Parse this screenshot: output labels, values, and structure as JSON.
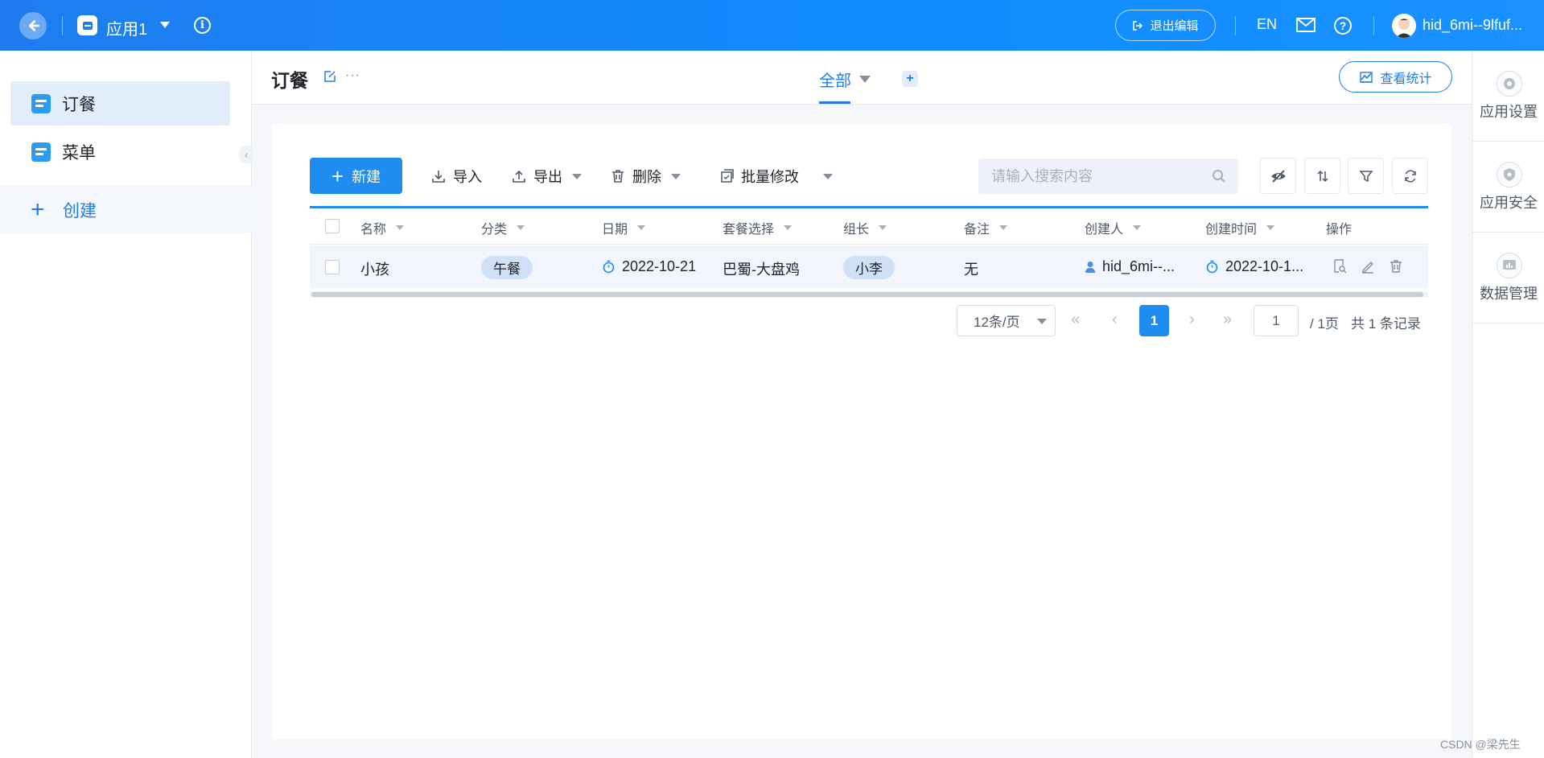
{
  "topbar": {
    "app_name": "应用1",
    "exit_edit_label": "退出编辑",
    "lang_label": "EN",
    "user_name": "hid_6mi--9lfuf..."
  },
  "sidebar": {
    "items": [
      {
        "label": "订餐",
        "active": true
      },
      {
        "label": "菜单",
        "active": false
      }
    ],
    "create_label": "创建"
  },
  "rightpanel": {
    "items": [
      {
        "label": "应用设置",
        "icon": "gear-icon"
      },
      {
        "label": "应用安全",
        "icon": "shield-icon"
      },
      {
        "label": "数据管理",
        "icon": "chart-icon"
      }
    ]
  },
  "header": {
    "title": "订餐",
    "more": "···",
    "tab_label": "全部",
    "add_tab": "+",
    "stats_label": "查看统计"
  },
  "toolbar": {
    "new_label": "新建",
    "import_label": "导入",
    "export_label": "导出",
    "delete_label": "删除",
    "batch_edit_label": "批量修改",
    "search_placeholder": "请输入搜索内容"
  },
  "table": {
    "columns": [
      "名称",
      "分类",
      "日期",
      "套餐选择",
      "组长",
      "备注",
      "创建人",
      "创建时间",
      "操作"
    ],
    "rows": [
      {
        "name": "小孩",
        "category": "午餐",
        "date": "2022-10-21",
        "meal": "巴蜀-大盘鸡",
        "leader": "小李",
        "remark": "无",
        "creator": "hid_6mi--...",
        "created_at": "2022-10-1..."
      }
    ]
  },
  "pagination": {
    "page_size": "12条/页",
    "current_page": "1",
    "page_input": "1",
    "total_pages_text": "/ 1页",
    "total_records_text": "共 1 条记录"
  },
  "watermark": "CSDN @梁先生",
  "colors": {
    "accent": "#1f8cf0",
    "topbar": "#1f7cf0",
    "tag_bg": "#cfe0f7",
    "row_bg": "#f2f6fc"
  }
}
